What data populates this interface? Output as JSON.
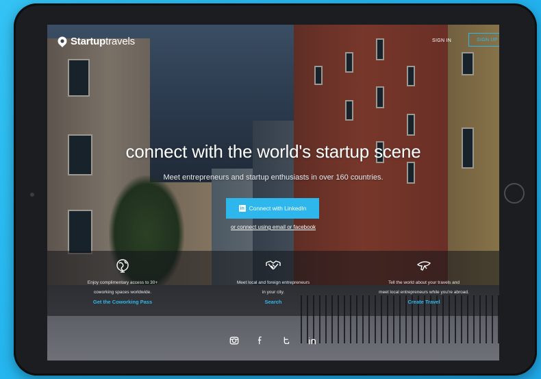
{
  "header": {
    "logo_bold": "Startup",
    "logo_light": "travels",
    "signin_label": "SIGN IN",
    "signup_label": "SIGN UP"
  },
  "hero": {
    "title": "connect with the world's startup scene",
    "subtitle": "Meet entrepreneurs and startup enthusiasts in over 160 countries.",
    "linkedin_button_label": "Connect with LinkedIn",
    "alt_link": "or connect using email or facebook"
  },
  "features": [
    {
      "icon": "globe-icon",
      "text_line1": "Enjoy complimentary access to 30+",
      "text_line2": "coworking spaces worldwide.",
      "link": "Get the Coworking Pass"
    },
    {
      "icon": "handshake-icon",
      "text_line1": "Meet local and foreign entrepreneurs",
      "text_line2": "in your city.",
      "link": "Search"
    },
    {
      "icon": "airplane-icon",
      "text_line1": "Tell the world about your travels and",
      "text_line2": "meet local entrepreneurs while you're abroad.",
      "link": "Create Travel"
    }
  ],
  "social": [
    "instagram-icon",
    "facebook-icon",
    "twitter-icon",
    "linkedin-icon"
  ],
  "colors": {
    "accent": "#2eb7ec",
    "page_background": "#23b4ee",
    "device_frame": "#1c1d20"
  }
}
